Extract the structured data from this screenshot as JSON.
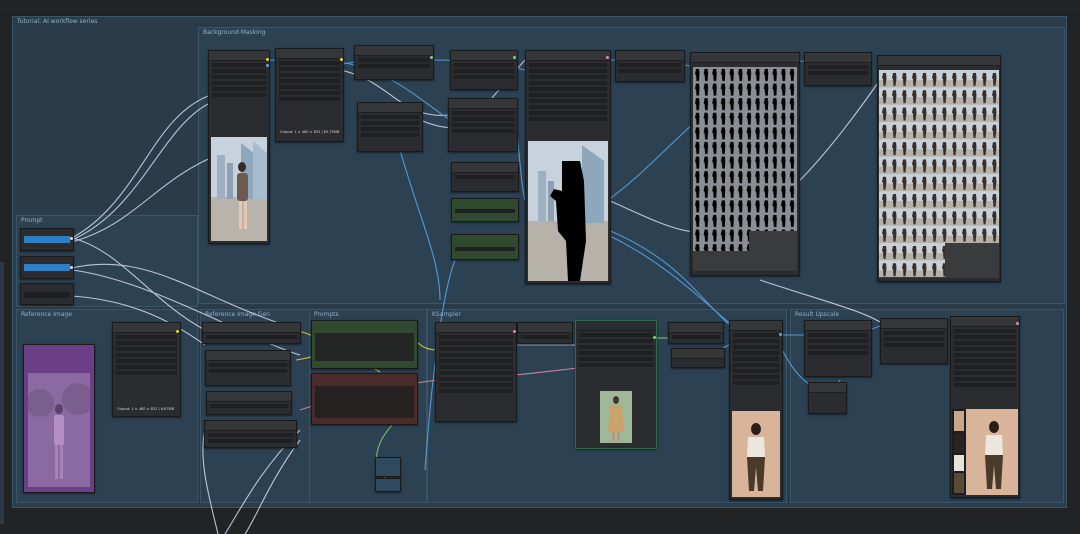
{
  "workflow": {
    "title": "Tutorial: AI workflow series"
  },
  "groups": {
    "background": "Background Masking",
    "prompt": "Prompt",
    "reference": "Reference Image",
    "gen_a": "Reference Image Gen",
    "gen_b": "Prompts",
    "sampler": "KSampler",
    "refine": "Result Upscale"
  },
  "captions": {
    "source_output": "Output: 1 × 480 × 832 | 65.75MB",
    "ref_output": "Output: 1 × 480 × 832 | 6.67MB"
  },
  "colors": {
    "canvas": "#222325",
    "group": "#2c4253",
    "node": "#2b2c2f",
    "wire_blue": "#5aa7e6",
    "wire_white": "#d9d9f0",
    "wire_pink": "#e58aa8",
    "wire_green": "#7fd07f",
    "positive_node": "#2f4a2e",
    "negative_node": "#4b2a2a",
    "reference_node": "#6a3f86"
  }
}
